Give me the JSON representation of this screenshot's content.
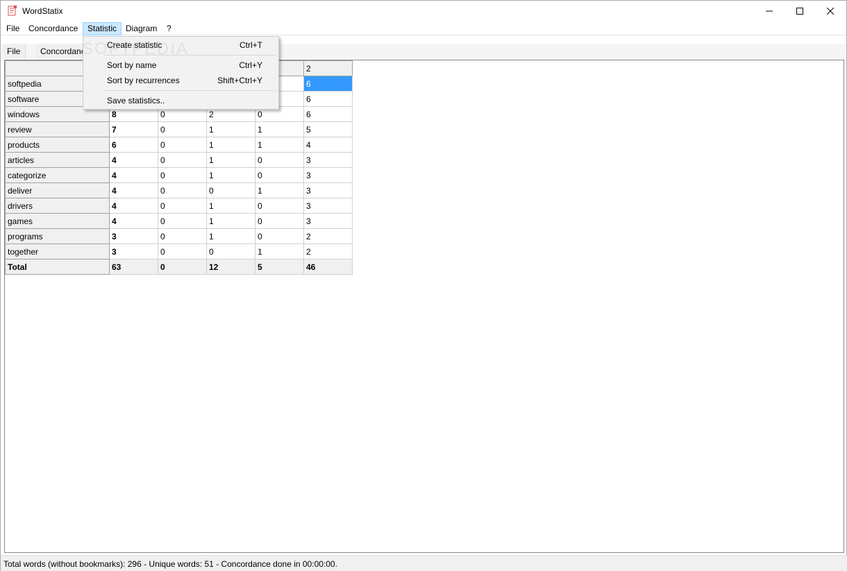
{
  "window": {
    "title": "WordStatix"
  },
  "menubar": [
    "File",
    "Concordance",
    "Statistic",
    "Diagram",
    "?"
  ],
  "subtabs": [
    "File",
    "Concordance"
  ],
  "dropdown": {
    "items": [
      {
        "label": "Create statistic",
        "shortcut": "Ctrl+T"
      },
      {
        "label": "Sort by name",
        "shortcut": "Ctrl+Y"
      },
      {
        "label": "Sort by recurrences",
        "shortcut": "Shift+Ctrl+Y"
      },
      {
        "label": "Save statistics..",
        "shortcut": ""
      }
    ]
  },
  "watermark": "SOFTPEDIA",
  "table": {
    "header_last": "2",
    "rows": [
      {
        "word": "softpedia",
        "cells": [
          "",
          "",
          "",
          "",
          "6"
        ]
      },
      {
        "word": "software",
        "cells": [
          "",
          "",
          "",
          "",
          "6"
        ]
      },
      {
        "word": "windows",
        "cells": [
          "8",
          "0",
          "2",
          "0",
          "6"
        ]
      },
      {
        "word": "review",
        "cells": [
          "7",
          "0",
          "1",
          "1",
          "5"
        ]
      },
      {
        "word": "products",
        "cells": [
          "6",
          "0",
          "1",
          "1",
          "4"
        ]
      },
      {
        "word": "articles",
        "cells": [
          "4",
          "0",
          "1",
          "0",
          "3"
        ]
      },
      {
        "word": "categorize",
        "cells": [
          "4",
          "0",
          "1",
          "0",
          "3"
        ]
      },
      {
        "word": "deliver",
        "cells": [
          "4",
          "0",
          "0",
          "1",
          "3"
        ]
      },
      {
        "word": "drivers",
        "cells": [
          "4",
          "0",
          "1",
          "0",
          "3"
        ]
      },
      {
        "word": "games",
        "cells": [
          "4",
          "0",
          "1",
          "0",
          "3"
        ]
      },
      {
        "word": "programs",
        "cells": [
          "3",
          "0",
          "1",
          "0",
          "2"
        ]
      },
      {
        "word": "together",
        "cells": [
          "3",
          "0",
          "0",
          "1",
          "2"
        ]
      }
    ],
    "total": {
      "word": "Total",
      "cells": [
        "63",
        "0",
        "12",
        "5",
        "46"
      ]
    }
  },
  "status": "Total words (without bookmarks): 296 - Unique words: 51 - Concordance done in 00:00:00.",
  "colors": {
    "selection": "#3399ff",
    "menu_highlight": "#cce8ff"
  }
}
